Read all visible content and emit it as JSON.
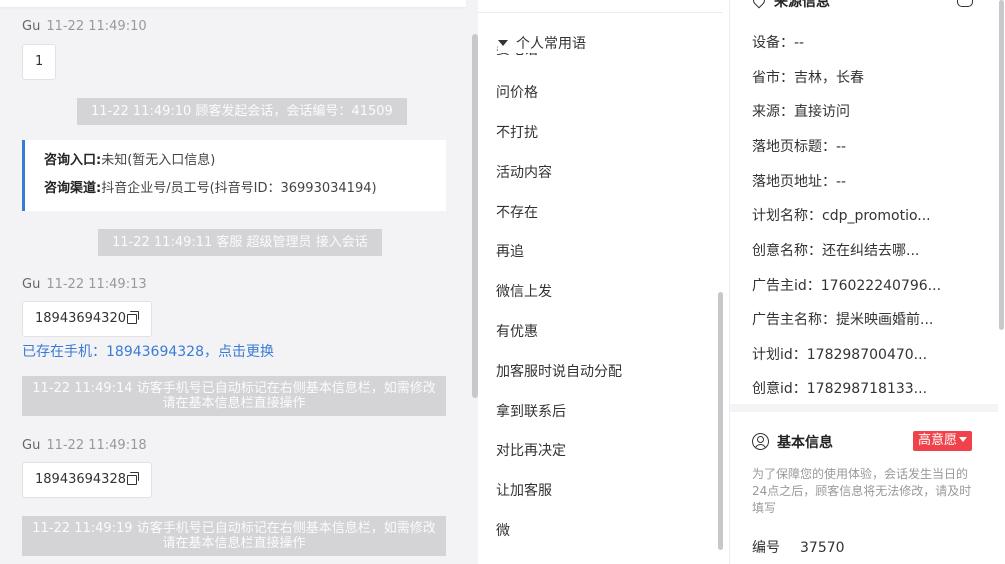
{
  "chat": {
    "messages": [
      {
        "sender": "Gu",
        "time": "11-22 11:49:10",
        "text": "1"
      },
      {
        "sender": "Gu",
        "time": "11-22 11:49:13",
        "text": "18943694320"
      },
      {
        "sender": "Gu",
        "time": "11-22 11:49:18",
        "text": "18943694328"
      }
    ],
    "system": {
      "session_start": "11-22 11:49:10 顾客发起会话，会话编号：41509",
      "agent_join": "11-22 11:49:11 客服 超级管理员 接入会话",
      "phone_marked_1_line1": "11-22 11:49:14 访客手机号已自动标记在右侧基本信息栏，如需修改",
      "phone_marked_1_line2": "请在基本信息栏直接操作",
      "phone_marked_2_line1": "11-22 11:49:19 访客手机号已自动标记在右侧基本信息栏，如需修改",
      "phone_marked_2_line2": "请在基本信息栏直接操作"
    },
    "entry": {
      "entry_label": "咨询入口:",
      "entry_value": "未知(暂无入口信息)",
      "channel_label": "咨询渠道:",
      "channel_value": "抖音企业号/员工号(抖音号ID：36993034194)"
    },
    "phone_exists_link": "已存在手机：18943694328，点击更换"
  },
  "phrases": {
    "header": "个人常用语",
    "clipped_item": "要电话",
    "items": [
      "问价格",
      "不打扰",
      "活动内容",
      "不存在",
      "再追",
      "微信上发",
      "有优惠",
      "加客服时说自动分配",
      "拿到联系后",
      "对比再决定",
      "让加客服",
      "微"
    ]
  },
  "info": {
    "source_title": "来源信息",
    "rows": [
      "设备：--",
      "省市：吉林，长春",
      "来源：直接访问",
      "落地页标题：--",
      "落地页地址：--",
      "计划名称：cdp_promotio...",
      "创意名称：还在纠结去哪...",
      "广告主id：176022240796...",
      "广告主名称：提米映画婚前...",
      "计划id：178298700470...",
      "创意id：178298718133..."
    ],
    "basic_title": "基本信息",
    "intent_badge": "高意愿",
    "notice": "为了保障您的使用体验，会话发生当日的24点之后，顾客信息将无法修改，请及时填写",
    "id_label": "编号",
    "id_value": "37570"
  },
  "colors": {
    "accent_blue": "#3a7bd5",
    "badge_red": "#f0424a",
    "system_msg_bg": "#d4d4d7"
  }
}
